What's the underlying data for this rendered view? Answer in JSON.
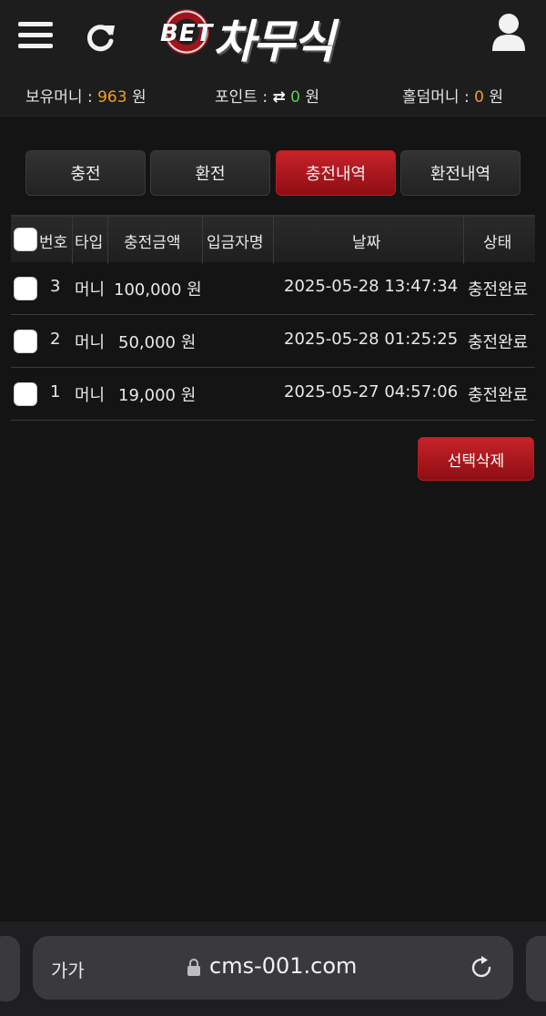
{
  "header": {
    "logo_prefix": "BET",
    "logo_name": "차무식"
  },
  "info": {
    "money_label": "보유머니 : ",
    "money_value": "963",
    "money_unit": " 원",
    "point_label": "포인트 : ",
    "point_icon": "⇄",
    "point_value": "0",
    "point_unit": " 원",
    "hold_label": "홀덤머니 : ",
    "hold_value": "0",
    "hold_unit": " 원"
  },
  "tabs": [
    {
      "label": "충전",
      "active": false
    },
    {
      "label": "환전",
      "active": false
    },
    {
      "label": "충전내역",
      "active": true
    },
    {
      "label": "환전내역",
      "active": false
    }
  ],
  "table": {
    "headers": [
      "번호",
      "타입",
      "충전금액",
      "입금자명",
      "날짜",
      "상태"
    ],
    "rows": [
      {
        "no": "3",
        "type": "머니",
        "amount": "100,000 원",
        "depositor": "",
        "date": "2025-05-28 13:47:34",
        "status": "충전완료"
      },
      {
        "no": "2",
        "type": "머니",
        "amount": "50,000 원",
        "depositor": "",
        "date": "2025-05-28 01:25:25",
        "status": "충전완료"
      },
      {
        "no": "1",
        "type": "머니",
        "amount": "19,000 원",
        "depositor": "",
        "date": "2025-05-27 04:57:06",
        "status": "충전완료"
      }
    ]
  },
  "actions": {
    "delete_selected": "선택삭제"
  },
  "browser": {
    "reader_label": "가가",
    "url": "cms-001.com"
  },
  "colors": {
    "accent_red": "#b81a22",
    "money_orange": "#f0a020",
    "point_green": "#56d24a"
  }
}
